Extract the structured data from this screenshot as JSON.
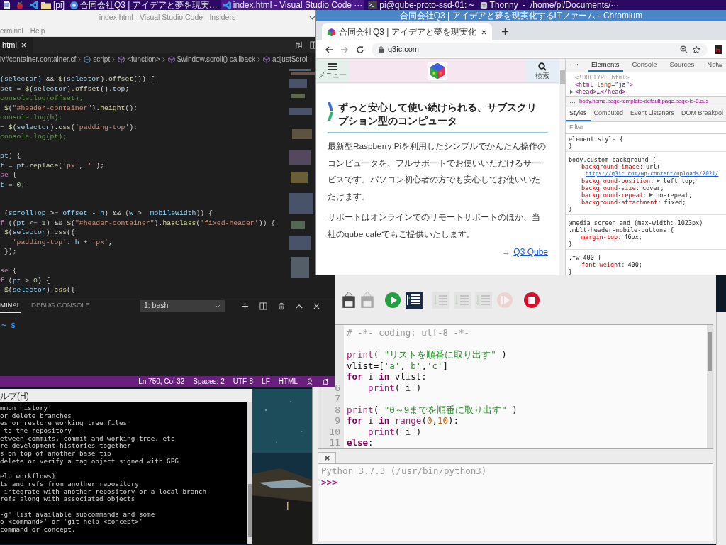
{
  "taskbar": {
    "tasks": [
      {
        "kind": "folder",
        "label": "[pi]",
        "selected": false
      },
      {
        "kind": "browser",
        "label": "合同会社Q3 | アイデアと夢を現実…",
        "selected": false
      },
      {
        "kind": "editor",
        "label": "index.html - Visual Studio Code ···",
        "selected": true
      },
      {
        "kind": "terminal",
        "label": "pi@qube-proto-ssd-01: ~",
        "selected": false
      },
      {
        "kind": "ide",
        "label": "Thonny  -  /home/pi/Documents/···",
        "selected": false
      }
    ]
  },
  "vscode": {
    "title": "index.html - Visual Studio Code - Insiders",
    "menu": [
      "erminal",
      "Help"
    ],
    "tab": ".html",
    "breadcrumbs": [
      {
        "kind": "plain",
        "label": "iv#container.container.cf"
      },
      {
        "kind": "module",
        "label": "script"
      },
      {
        "kind": "cube",
        "label": "<function>"
      },
      {
        "kind": "cube",
        "label": "$window.scroll() callback"
      },
      {
        "kind": "cube",
        "label": "adjustScroll"
      }
    ],
    "code_lines": [
      {
        "kind": "code",
        "segments": [
          {
            "kind": "var",
            "text": "(selector) "
          },
          {
            "kind": "plain",
            "text": "&& "
          },
          {
            "kind": "func",
            "text": "$"
          },
          {
            "kind": "plain",
            "text": "("
          },
          {
            "kind": "var",
            "text": "selector"
          },
          {
            "kind": "plain",
            "text": ")."
          },
          {
            "kind": "func",
            "text": "offset"
          },
          {
            "kind": "plain",
            "text": "()) {"
          }
        ]
      },
      {
        "kind": "code",
        "segments": [
          {
            "kind": "var",
            "text": "set"
          },
          {
            "kind": "plain",
            "text": " = "
          },
          {
            "kind": "func",
            "text": "$"
          },
          {
            "kind": "plain",
            "text": "("
          },
          {
            "kind": "var",
            "text": "selector"
          },
          {
            "kind": "plain",
            "text": ")."
          },
          {
            "kind": "func",
            "text": "offset"
          },
          {
            "kind": "plain",
            "text": "()."
          },
          {
            "kind": "var",
            "text": "top"
          },
          {
            "kind": "plain",
            "text": ";"
          }
        ]
      },
      {
        "kind": "code",
        "segments": [
          {
            "kind": "comment",
            "text": "console.log(offset);"
          }
        ]
      },
      {
        "kind": "code",
        "segments": [
          {
            "kind": "func",
            "text": " $"
          },
          {
            "kind": "plain",
            "text": "("
          },
          {
            "kind": "string",
            "text": "\"#header-container\""
          },
          {
            "kind": "plain",
            "text": ")."
          },
          {
            "kind": "func",
            "text": "height"
          },
          {
            "kind": "plain",
            "text": "();"
          }
        ]
      },
      {
        "kind": "code",
        "segments": [
          {
            "kind": "comment",
            "text": "console.log(h);"
          }
        ]
      },
      {
        "kind": "code",
        "segments": [
          {
            "kind": "plain",
            "text": "= "
          },
          {
            "kind": "func",
            "text": "$"
          },
          {
            "kind": "plain",
            "text": "("
          },
          {
            "kind": "var",
            "text": "selector"
          },
          {
            "kind": "plain",
            "text": ")."
          },
          {
            "kind": "func",
            "text": "css"
          },
          {
            "kind": "plain",
            "text": "("
          },
          {
            "kind": "string",
            "text": "'padding-top'"
          },
          {
            "kind": "plain",
            "text": ");"
          }
        ]
      },
      {
        "kind": "code",
        "segments": [
          {
            "kind": "comment",
            "text": "console.log(pt);"
          }
        ]
      },
      {
        "kind": "blank"
      },
      {
        "kind": "code",
        "segments": [
          {
            "kind": "var",
            "text": "pt"
          },
          {
            "kind": "plain",
            "text": ") {"
          }
        ]
      },
      {
        "kind": "code",
        "segments": [
          {
            "kind": "var",
            "text": "t"
          },
          {
            "kind": "plain",
            "text": " = "
          },
          {
            "kind": "var",
            "text": "pt"
          },
          {
            "kind": "plain",
            "text": "."
          },
          {
            "kind": "func",
            "text": "replace"
          },
          {
            "kind": "plain",
            "text": "("
          },
          {
            "kind": "string",
            "text": "'px'"
          },
          {
            "kind": "plain",
            "text": ", "
          },
          {
            "kind": "string",
            "text": "''"
          },
          {
            "kind": "plain",
            "text": ");"
          }
        ]
      },
      {
        "kind": "code",
        "segments": [
          {
            "kind": "keyword",
            "text": "se"
          },
          {
            "kind": "plain",
            "text": " {"
          }
        ]
      },
      {
        "kind": "code",
        "segments": [
          {
            "kind": "var",
            "text": "t"
          },
          {
            "kind": "plain",
            "text": " = "
          },
          {
            "kind": "number",
            "text": "0"
          },
          {
            "kind": "plain",
            "text": ";"
          }
        ]
      },
      {
        "kind": "blank"
      },
      {
        "kind": "blank"
      },
      {
        "kind": "code",
        "segments": [
          {
            "kind": "plain",
            "text": " ("
          },
          {
            "kind": "var",
            "text": "scrollTop"
          },
          {
            "kind": "plain",
            "text": " >= "
          },
          {
            "kind": "var",
            "text": "offset"
          },
          {
            "kind": "plain",
            "text": " - "
          },
          {
            "kind": "var",
            "text": "h"
          },
          {
            "kind": "plain",
            "text": ") && ("
          },
          {
            "kind": "var",
            "text": "w"
          },
          {
            "kind": "plain",
            "text": " >  "
          },
          {
            "kind": "var",
            "text": "mobileWidth"
          },
          {
            "kind": "plain",
            "text": ")) {"
          }
        ]
      },
      {
        "kind": "code",
        "segments": [
          {
            "kind": "keyword",
            "text": "f"
          },
          {
            "kind": "plain",
            "text": " (("
          },
          {
            "kind": "var",
            "text": "pt"
          },
          {
            "kind": "plain",
            "text": " <= "
          },
          {
            "kind": "number",
            "text": "1"
          },
          {
            "kind": "plain",
            "text": ") && "
          },
          {
            "kind": "func",
            "text": "$"
          },
          {
            "kind": "plain",
            "text": "("
          },
          {
            "kind": "string",
            "text": "\"#header-container\""
          },
          {
            "kind": "plain",
            "text": ")."
          },
          {
            "kind": "func",
            "text": "hasClass"
          },
          {
            "kind": "plain",
            "text": "("
          },
          {
            "kind": "string",
            "text": "'fixed-header'"
          },
          {
            "kind": "plain",
            "text": ")) {"
          }
        ]
      },
      {
        "kind": "code",
        "segments": [
          {
            "kind": "func",
            "text": " $"
          },
          {
            "kind": "plain",
            "text": "("
          },
          {
            "kind": "var",
            "text": "selector"
          },
          {
            "kind": "plain",
            "text": ")."
          },
          {
            "kind": "func",
            "text": "css"
          },
          {
            "kind": "plain",
            "text": "({"
          }
        ]
      },
      {
        "kind": "code",
        "segments": [
          {
            "kind": "string",
            "text": "   'padding-top'"
          },
          {
            "kind": "plain",
            "text": ": "
          },
          {
            "kind": "var",
            "text": "h"
          },
          {
            "kind": "plain",
            "text": " + "
          },
          {
            "kind": "string",
            "text": "'px'"
          },
          {
            "kind": "plain",
            "text": ","
          }
        ]
      },
      {
        "kind": "code",
        "segments": [
          {
            "kind": "plain",
            "text": " });"
          }
        ]
      },
      {
        "kind": "blank"
      },
      {
        "kind": "code",
        "segments": [
          {
            "kind": "keyword",
            "text": "se"
          },
          {
            "kind": "plain",
            "text": " {"
          }
        ]
      },
      {
        "kind": "code",
        "segments": [
          {
            "kind": "keyword",
            "text": "f"
          },
          {
            "kind": "plain",
            "text": " ("
          },
          {
            "kind": "var",
            "text": "pt"
          },
          {
            "kind": "plain",
            "text": " > "
          },
          {
            "kind": "number",
            "text": "0"
          },
          {
            "kind": "plain",
            "text": ") {"
          }
        ]
      },
      {
        "kind": "code",
        "segments": [
          {
            "kind": "func",
            "text": " $"
          },
          {
            "kind": "plain",
            "text": "("
          },
          {
            "kind": "var",
            "text": "selector"
          },
          {
            "kind": "plain",
            "text": ")."
          },
          {
            "kind": "func",
            "text": "css"
          },
          {
            "kind": "plain",
            "text": "({"
          }
        ]
      }
    ],
    "panel": {
      "tabs": [
        {
          "label": "MINAL",
          "selected": true
        },
        {
          "label": "DEBUG CONSOLE",
          "selected": false
        }
      ],
      "terminal_select": "1: bash",
      "prompt": "~ $"
    },
    "status_bar": [
      "Ln 750, Col 32",
      "Spaces: 2",
      "UTF-8",
      "LF",
      "HTML"
    ]
  },
  "chromium": {
    "title": "合同会社Q3 | アイデアと夢を現実化するITファーム - Chromium",
    "tab": "合同会社Q3 | アイデアと夢を現実化",
    "url": "q3ic.com",
    "page": {
      "menu_label": "メニュー",
      "search_label": "検索",
      "heading": "ずっと安心して使い続けられる、サブスクリプション型のコンピュータ",
      "paragraphs": [
        "最新型Raspberry Piを利用したシンプルでかんたん操作のコンピュータを、フルサポートでお使いいただけるサービスです。パソコン初心者の方でも安心してお使いいただけます。",
        "サポートはオンラインでのリモートサポートのほか、当社のqube cafeでもご提供いたします。"
      ],
      "link_arrow": "→",
      "link": "Q3 Qube"
    },
    "devtools": {
      "tabs": [
        {
          "label": "Elements",
          "selected": true
        },
        {
          "label": "Console",
          "selected": false
        },
        {
          "label": "Sources",
          "selected": false
        },
        {
          "label": "Netw",
          "selected": false
        }
      ],
      "dom_lines": [
        {
          "expandable": false,
          "segments": [
            {
              "kind": "doctype",
              "text": "<!DOCTYPE html>"
            }
          ]
        },
        {
          "expandable": false,
          "segments": [
            {
              "kind": "tag",
              "text": "<html "
            },
            {
              "kind": "attr",
              "text": "lang"
            },
            {
              "kind": "plain",
              "text": "="
            },
            {
              "kind": "value",
              "text": "\"ja\""
            },
            {
              "kind": "tag",
              "text": ">"
            }
          ]
        },
        {
          "expandable": true,
          "segments": [
            {
              "kind": "tag",
              "text": "<head>"
            },
            {
              "kind": "plain",
              "text": "…"
            },
            {
              "kind": "tag",
              "text": "</head>"
            }
          ]
        }
      ],
      "breadcrumb_more": "…",
      "breadcrumb": "body.home.page-template-default.page.page-id-8.cus",
      "style_tabs": [
        {
          "label": "Styles",
          "selected": true
        },
        {
          "label": "Computed",
          "selected": false
        },
        {
          "label": "Event Listeners",
          "selected": false
        },
        {
          "label": "DOM Breakpoi",
          "selected": false
        }
      ],
      "filter_placeholder": "Filter",
      "style_lines": [
        {
          "kind": "selector",
          "text": "element.style {"
        },
        {
          "kind": "close",
          "text": "}"
        },
        {
          "kind": "selector",
          "text": "body.custom-background {"
        },
        {
          "kind": "prop",
          "name": "background-image:",
          "value": "url(",
          "expandable": false
        },
        {
          "kind": "url",
          "text": "https://q3ic.com/wp-content/uploads/2021/"
        },
        {
          "kind": "prop",
          "name": "background-position:",
          "value": "left top;",
          "expandable": true
        },
        {
          "kind": "prop",
          "name": "background-size:",
          "value": "cover;",
          "expandable": false
        },
        {
          "kind": "prop",
          "name": "background-repeat:",
          "value": "no-repeat;",
          "expandable": true
        },
        {
          "kind": "prop",
          "name": "background-attachment:",
          "value": "fixed;",
          "expandable": false
        },
        {
          "kind": "close",
          "text": "}"
        },
        {
          "kind": "media",
          "text": "@media screen and (max-width: 1023px)"
        },
        {
          "kind": "selector",
          "text": ".mblt-header-mobile-buttons {"
        },
        {
          "kind": "prop",
          "name": "margin-top:",
          "value": "46px;",
          "expandable": false
        },
        {
          "kind": "close",
          "text": "}"
        },
        {
          "kind": "selector",
          "text": ".fw-400 {"
        },
        {
          "kind": "prop",
          "name": "font-weight:",
          "value": "400;",
          "expandable": false
        },
        {
          "kind": "close",
          "text": "}"
        }
      ]
    }
  },
  "terminal": {
    "menu": "ルプ(H)",
    "line_groups": [
      [
        "mmon history",
        "or delete branches",
        "es or restore working tree files",
        " to the repository",
        "etween commits, commit and working tree, etc",
        "re development histories together",
        "s on top of another base tip",
        "delete or verify a tag object signed with GPG"
      ],
      [
        "elp workflows)",
        "ts and refs from another repository",
        " integrate with another repository or a local branch",
        "refs along with associated objects"
      ],
      [
        "-g' list available subcommands and some",
        "o <command>' or 'git help <concept>'",
        "command or concept."
      ]
    ]
  },
  "thonny": {
    "toolbar": [
      {
        "kind": "save",
        "disabled": false
      },
      {
        "kind": "save",
        "disabled": true
      },
      {
        "kind": "run",
        "disabled": false
      },
      {
        "kind": "debug",
        "disabled": false
      },
      {
        "kind": "step",
        "disabled": true
      },
      {
        "kind": "step",
        "disabled": true
      },
      {
        "kind": "step",
        "disabled": true
      },
      {
        "kind": "resume",
        "disabled": true
      },
      {
        "kind": "stop",
        "disabled": false
      }
    ],
    "lines": [
      {
        "kind": "code",
        "segments": [
          {
            "kind": "comment",
            "text": "# -*- coding: utf-8 -*-"
          }
        ]
      },
      {
        "kind": "blank"
      },
      {
        "kind": "code",
        "segments": [
          {
            "kind": "builtin",
            "text": "print"
          },
          {
            "kind": "plain",
            "text": "( "
          },
          {
            "kind": "string",
            "text": "\"リストを順番に取り出す\""
          },
          {
            "kind": "plain",
            "text": " )"
          }
        ]
      },
      {
        "kind": "code",
        "segments": [
          {
            "kind": "plain",
            "text": "vlist=["
          },
          {
            "kind": "string",
            "text": "'a'"
          },
          {
            "kind": "plain",
            "text": ","
          },
          {
            "kind": "string",
            "text": "'b'"
          },
          {
            "kind": "plain",
            "text": ","
          },
          {
            "kind": "string",
            "text": "'c'"
          },
          {
            "kind": "plain",
            "text": "]"
          }
        ]
      },
      {
        "kind": "code",
        "segments": [
          {
            "kind": "keyword",
            "text": "for"
          },
          {
            "kind": "plain",
            "text": " i "
          },
          {
            "kind": "keyword",
            "text": "in"
          },
          {
            "kind": "plain",
            "text": " vlist:"
          }
        ]
      },
      {
        "kind": "code",
        "number": "6",
        "segments": [
          {
            "kind": "builtin",
            "text": "    print"
          },
          {
            "kind": "plain",
            "text": "( i )"
          }
        ]
      },
      {
        "kind": "blank",
        "number": "7"
      },
      {
        "kind": "code",
        "number": "8",
        "segments": [
          {
            "kind": "builtin",
            "text": "print"
          },
          {
            "kind": "plain",
            "text": "( "
          },
          {
            "kind": "string",
            "text": "\"0～9までを順番に取り出す\""
          },
          {
            "kind": "plain",
            "text": " )"
          }
        ]
      },
      {
        "kind": "code",
        "number": "9",
        "segments": [
          {
            "kind": "keyword",
            "text": "for"
          },
          {
            "kind": "plain",
            "text": " i "
          },
          {
            "kind": "keyword",
            "text": "in"
          },
          {
            "kind": "builtin",
            "text": " range"
          },
          {
            "kind": "plain",
            "text": "("
          },
          {
            "kind": "number",
            "text": "0"
          },
          {
            "kind": "plain",
            "text": ","
          },
          {
            "kind": "number",
            "text": "10"
          },
          {
            "kind": "plain",
            "text": "):"
          }
        ]
      },
      {
        "kind": "code",
        "number": "10",
        "segments": [
          {
            "kind": "builtin",
            "text": "    print"
          },
          {
            "kind": "plain",
            "text": "( i )"
          }
        ]
      },
      {
        "kind": "code",
        "number": "11",
        "segments": [
          {
            "kind": "keyword",
            "text": "else"
          },
          {
            "kind": "plain",
            "text": ":"
          }
        ]
      }
    ],
    "shell": {
      "banner": "Python 3.7.3 (/usr/bin/python3)",
      "prompt": ">>>"
    }
  }
}
